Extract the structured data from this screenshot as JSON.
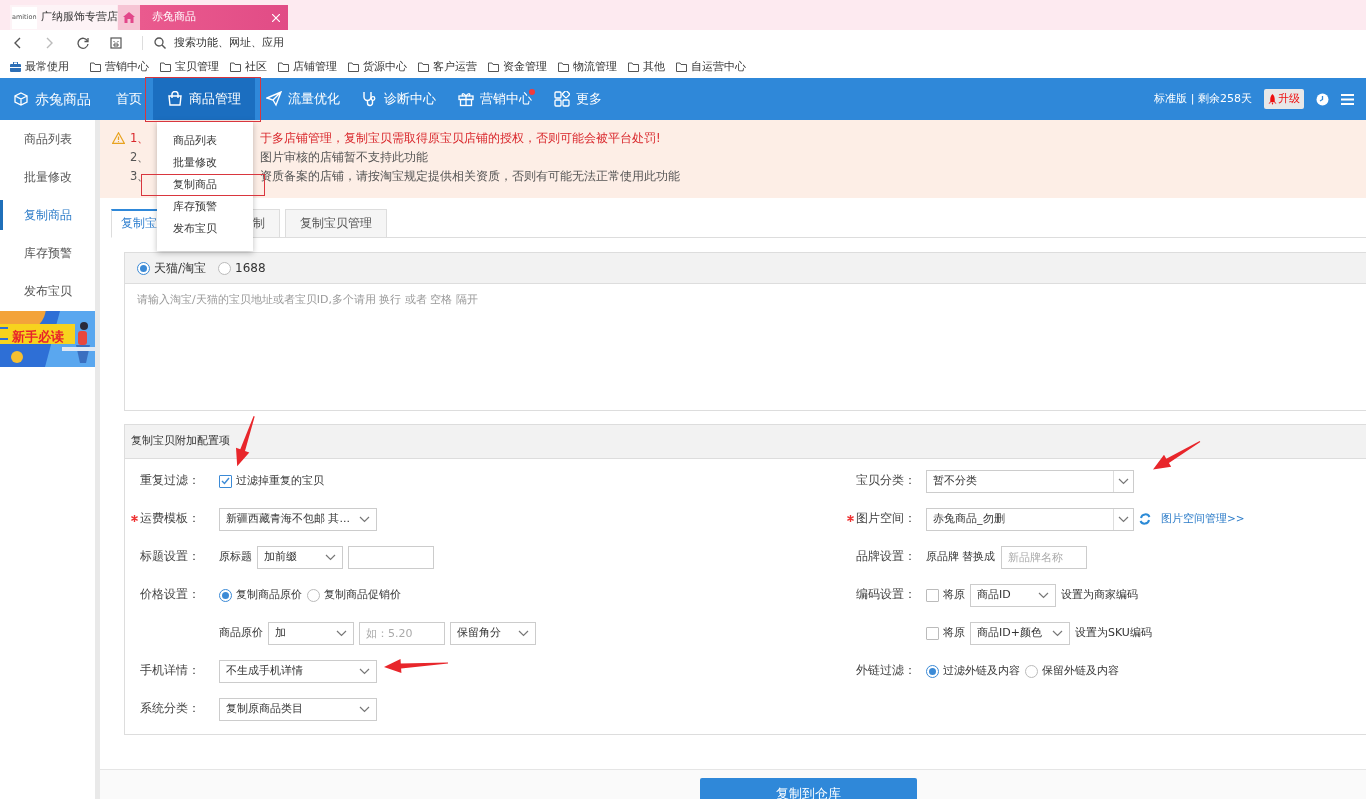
{
  "browser": {
    "tabs": [
      {
        "label": "广纳服饰专营店",
        "logo": "amition",
        "selected": false
      },
      {
        "label": "赤兔商品",
        "selected": true
      }
    ],
    "address": {
      "placeholder": "搜索功能、网址、应用"
    },
    "bookmarks": [
      {
        "label": "最常使用",
        "kind": "special"
      },
      {
        "label": "营销中心",
        "kind": "folder"
      },
      {
        "label": "宝贝管理",
        "kind": "folder"
      },
      {
        "label": "社区",
        "kind": "folder"
      },
      {
        "label": "店铺管理",
        "kind": "folder"
      },
      {
        "label": "货源中心",
        "kind": "folder"
      },
      {
        "label": "客户运营",
        "kind": "folder"
      },
      {
        "label": "资金管理",
        "kind": "folder"
      },
      {
        "label": "物流管理",
        "kind": "folder"
      },
      {
        "label": "其他",
        "kind": "folder"
      },
      {
        "label": "自运营中心",
        "kind": "folder"
      }
    ]
  },
  "navbar": {
    "brand": "赤兔商品",
    "items": [
      {
        "label": "首页",
        "selected": false,
        "dot": false
      },
      {
        "label": "商品管理",
        "selected": true,
        "dot": false
      },
      {
        "label": "流量优化",
        "selected": false,
        "dot": false
      },
      {
        "label": "诊断中心",
        "selected": false,
        "dot": false
      },
      {
        "label": "营销中心",
        "selected": false,
        "dot": true
      },
      {
        "label": "更多",
        "selected": false,
        "dot": false
      }
    ],
    "plan": "标准版 | 剩余258天",
    "upgrade": "升级"
  },
  "menu": {
    "items": [
      {
        "label": "商品列表",
        "selected": false
      },
      {
        "label": "批量修改",
        "selected": false
      },
      {
        "label": "复制商品",
        "selected": true
      },
      {
        "label": "库存预警",
        "selected": false
      },
      {
        "label": "发布宝贝",
        "selected": false
      }
    ]
  },
  "sidebar": {
    "items": [
      {
        "label": "商品列表",
        "selected": false
      },
      {
        "label": "批量修改",
        "selected": false
      },
      {
        "label": "复制商品",
        "selected": true
      },
      {
        "label": "库存预警",
        "selected": false
      },
      {
        "label": "发布宝贝",
        "selected": false
      }
    ],
    "banner": "新手必读"
  },
  "notice": {
    "lines": [
      {
        "before": "1、",
        "after": "于多店铺管理，复制宝贝需取得原宝贝店铺的授权，否则可能会被平台处罚!",
        "emphasis": true
      },
      {
        "before": "2、",
        "after": "图片审核的店铺暂不支持此功能",
        "emphasis": false
      },
      {
        "before": "3、",
        "after": "资质备案的店铺，请按淘宝规定提供相关资质，否则有可能无法正常使用此功能",
        "emphasis": false
      }
    ]
  },
  "tabs": [
    {
      "label": "复制宝",
      "selected": true
    },
    {
      "label": "制",
      "selected": false
    },
    {
      "label": "复制宝贝管理",
      "selected": false
    }
  ],
  "source": {
    "options": [
      {
        "label": "天猫/淘宝",
        "selected": true
      },
      {
        "label": "1688",
        "selected": false
      }
    ],
    "placeholder": "请输入淘宝/天猫的宝贝地址或者宝贝ID,多个请用 换行 或者 空格 隔开"
  },
  "config": {
    "title": "复制宝贝附加配置项",
    "columns": [
      {
        "rows": [
          {
            "label": "重复过滤：",
            "required": false,
            "items": [
              {
                "kind": "checkbox",
                "label": "过滤掉重复的宝贝",
                "checked": true
              }
            ]
          },
          {
            "label": "运费模板：",
            "required": true,
            "items": [
              {
                "kind": "select",
                "value": "新疆西藏青海不包邮 其..."
              }
            ]
          },
          {
            "label": "标题设置：",
            "required": false,
            "items": [
              {
                "kind": "text",
                "label": "原标题"
              },
              {
                "kind": "picker",
                "value": "加前缀"
              },
              {
                "kind": "input"
              }
            ]
          },
          {
            "label": "价格设置：",
            "required": false,
            "items": [
              {
                "kind": "radio",
                "label": "复制商品原价",
                "selected": true
              },
              {
                "kind": "radio",
                "label": "复制商品促销价",
                "selected": false
              }
            ]
          },
          {
            "required": false,
            "items": [
              {
                "kind": "text",
                "label": "商品原价"
              },
              {
                "kind": "picker",
                "value": "加"
              },
              {
                "kind": "input",
                "placeholder": "如：5.20"
              },
              {
                "kind": "picker",
                "value": "保留角分"
              }
            ]
          },
          {
            "label": "手机详情：",
            "required": false,
            "items": [
              {
                "kind": "select",
                "value": "不生成手机详情"
              }
            ]
          },
          {
            "label": "系统分类：",
            "required": false,
            "items": [
              {
                "kind": "select",
                "value": "复制原商品类目"
              }
            ]
          }
        ]
      },
      {
        "rows": [
          {
            "label": "宝贝分类：",
            "required": false,
            "items": [
              {
                "kind": "combo",
                "value": "暂不分类"
              }
            ]
          },
          {
            "label": "图片空间：",
            "required": true,
            "items": [
              {
                "kind": "combo",
                "value": "赤兔商品_勿删"
              },
              {
                "kind": "refresh"
              },
              {
                "kind": "link",
                "label": "图片空间管理>>"
              }
            ]
          },
          {
            "label": "品牌设置：",
            "required": false,
            "items": [
              {
                "kind": "text",
                "label": "原品牌 替换成"
              },
              {
                "kind": "input",
                "placeholder": "新品牌名称"
              }
            ]
          },
          {
            "label": "编码设置：",
            "required": false,
            "items": [
              {
                "kind": "checkbox",
                "label": "将原",
                "checked": false
              },
              {
                "kind": "picker",
                "value": "商品ID"
              },
              {
                "kind": "text",
                "label": "设置为商家编码"
              }
            ]
          },
          {
            "required": false,
            "items": [
              {
                "kind": "checkbox",
                "label": "将原",
                "checked": false
              },
              {
                "kind": "picker",
                "value": "商品ID+颜色"
              },
              {
                "kind": "text",
                "label": "设置为SKU编码"
              }
            ]
          },
          {
            "label": "外链过滤：",
            "required": false,
            "items": [
              {
                "kind": "radio",
                "label": "过滤外链及内容",
                "selected": true
              },
              {
                "kind": "radio",
                "label": "保留外链及内容",
                "selected": false
              }
            ]
          }
        ]
      }
    ]
  },
  "submit": "复制到仓库"
}
